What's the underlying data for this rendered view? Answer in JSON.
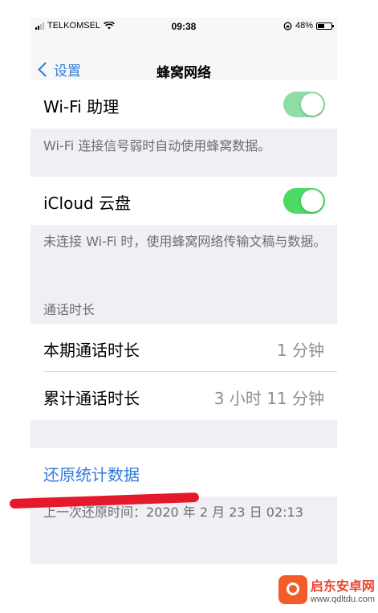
{
  "status_bar": {
    "carrier": "TELKOMSEL",
    "time": "09:38",
    "battery": "48%",
    "battery_level": 0.48
  },
  "nav": {
    "back_label": "设置",
    "title": "蜂窝网络"
  },
  "wifi_assist": {
    "label": "Wi-Fi 助理",
    "toggle_on": true,
    "footer": "Wi-Fi 连接信号弱时自动使用蜂窝数据。"
  },
  "icloud_drive": {
    "label": "iCloud 云盘",
    "toggle_on": true,
    "footer": "未连接 Wi-Fi 时，使用蜂窝网络传输文稿与数据。"
  },
  "call_time": {
    "header": "通话时长",
    "rows": [
      {
        "label": "本期通话时长",
        "value": "1 分钟"
      },
      {
        "label": "累计通话时长",
        "value": "3 小时 11 分钟"
      }
    ]
  },
  "reset": {
    "label": "还原统计数据",
    "footer": "上一次还原时间：2020 年 2 月 23 日 02:13"
  },
  "watermark": {
    "title": "启东安卓网",
    "url": "www.qdltdu.com"
  },
  "colors": {
    "accent": "#2f7bd9",
    "toggle_on": "#4cd964",
    "annotation_red": "#e5192c"
  }
}
